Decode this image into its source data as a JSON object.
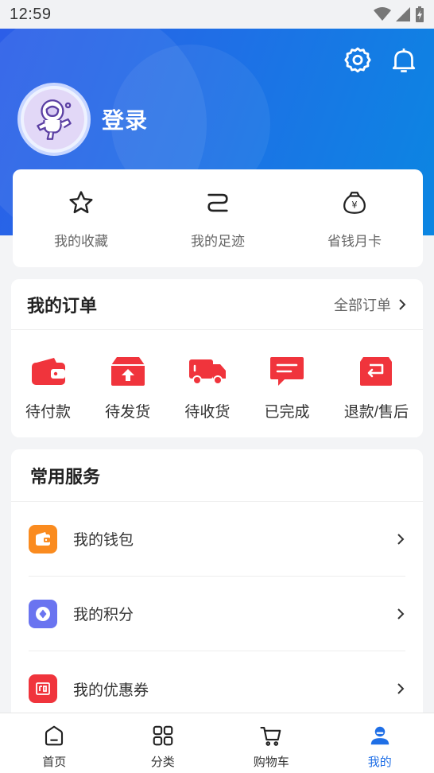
{
  "status_bar": {
    "time": "12:59"
  },
  "profile": {
    "login_label": "登录"
  },
  "quick_links": [
    {
      "label": "我的收藏",
      "icon": "star-icon"
    },
    {
      "label": "我的足迹",
      "icon": "footprint-icon"
    },
    {
      "label": "省钱月卡",
      "icon": "money-bag-icon"
    }
  ],
  "orders": {
    "title": "我的订单",
    "all_label": "全部订单",
    "items": [
      {
        "label": "待付款",
        "icon": "wallet-icon"
      },
      {
        "label": "待发货",
        "icon": "box-upload-icon"
      },
      {
        "label": "待收货",
        "icon": "truck-icon"
      },
      {
        "label": "已完成",
        "icon": "chat-check-icon"
      },
      {
        "label": "退款/售后",
        "icon": "refund-icon"
      }
    ]
  },
  "services": {
    "title": "常用服务",
    "items": [
      {
        "label": "我的钱包",
        "icon": "wallet-icon",
        "color": "#fa8b1f"
      },
      {
        "label": "我的积分",
        "icon": "points-icon",
        "color": "#6a74f0"
      },
      {
        "label": "我的优惠券",
        "icon": "coupon-icon",
        "color": "#f0343c"
      }
    ]
  },
  "tabs": [
    {
      "label": "首页",
      "icon": "home-icon"
    },
    {
      "label": "分类",
      "icon": "grid-icon"
    },
    {
      "label": "购物车",
      "icon": "cart-icon"
    },
    {
      "label": "我的",
      "icon": "user-icon",
      "active": true
    }
  ],
  "colors": {
    "primary": "#1f6fe6",
    "order_icon": "#f0343c"
  }
}
